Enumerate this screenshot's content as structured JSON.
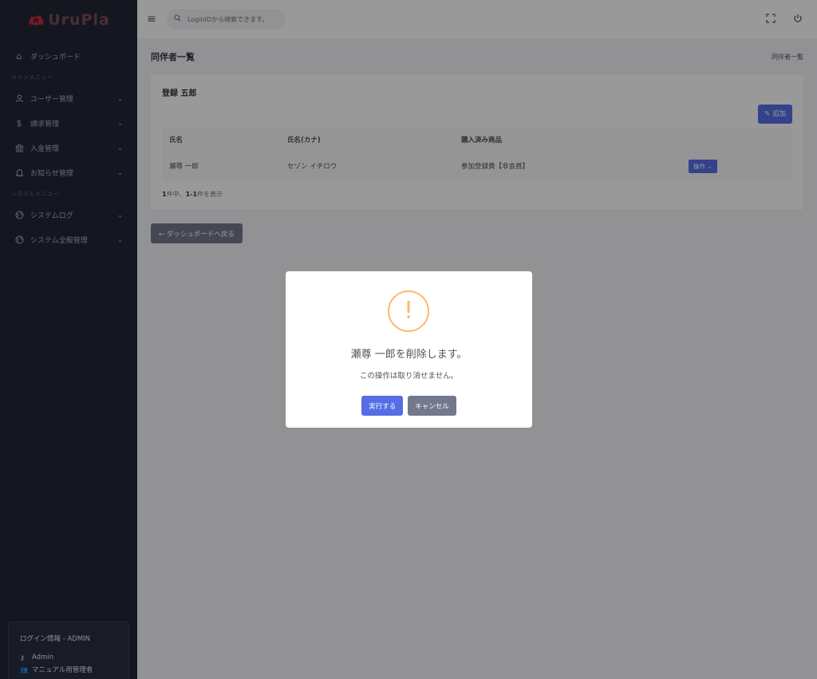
{
  "brand": {
    "name": "UruPla"
  },
  "header": {
    "search_placeholder": "LoginIDから検索できます。"
  },
  "sidebar": {
    "dashboard": "ダッシュボード",
    "main_menu_title": "メインメニュー",
    "main_items": [
      {
        "label": "ユーザー管理",
        "icon": "user-icon"
      },
      {
        "label": "請求管理",
        "icon": "dollar-icon"
      },
      {
        "label": "入金管理",
        "icon": "bank-icon"
      },
      {
        "label": "お知らせ管理",
        "icon": "bell-icon"
      }
    ],
    "system_menu_title": "システムメニュー",
    "system_items": [
      {
        "label": "システムログ",
        "icon": "globe-icon"
      },
      {
        "label": "システム全般管理",
        "icon": "globe-icon"
      }
    ]
  },
  "login_info": {
    "title": "ログイン情報 - ADMIN",
    "user": "Admin",
    "role": "マニュアル用管理者"
  },
  "page": {
    "title": "同伴者一覧",
    "breadcrumb": "同伴者一覧"
  },
  "card": {
    "title": "登録 五郎",
    "add_label": "追加",
    "columns": [
      "氏名",
      "氏名(カナ)",
      "購入済み商品",
      ""
    ],
    "rows": [
      {
        "name": "瀬尊 一郎",
        "kana": "セゾン イチロウ",
        "product": "参加登録費【非会員】",
        "action": "操作"
      }
    ],
    "count_prefix": "1",
    "count_mid1": "件中、",
    "count_range": "1-1",
    "count_suffix": "件を表示"
  },
  "back_button": "ダッシュボードへ戻る",
  "modal": {
    "icon": "!",
    "title": "瀬尊 一郎を削除します。",
    "text": "この操作は取り消せません。",
    "confirm": "実行する",
    "cancel": "キャンセル"
  }
}
